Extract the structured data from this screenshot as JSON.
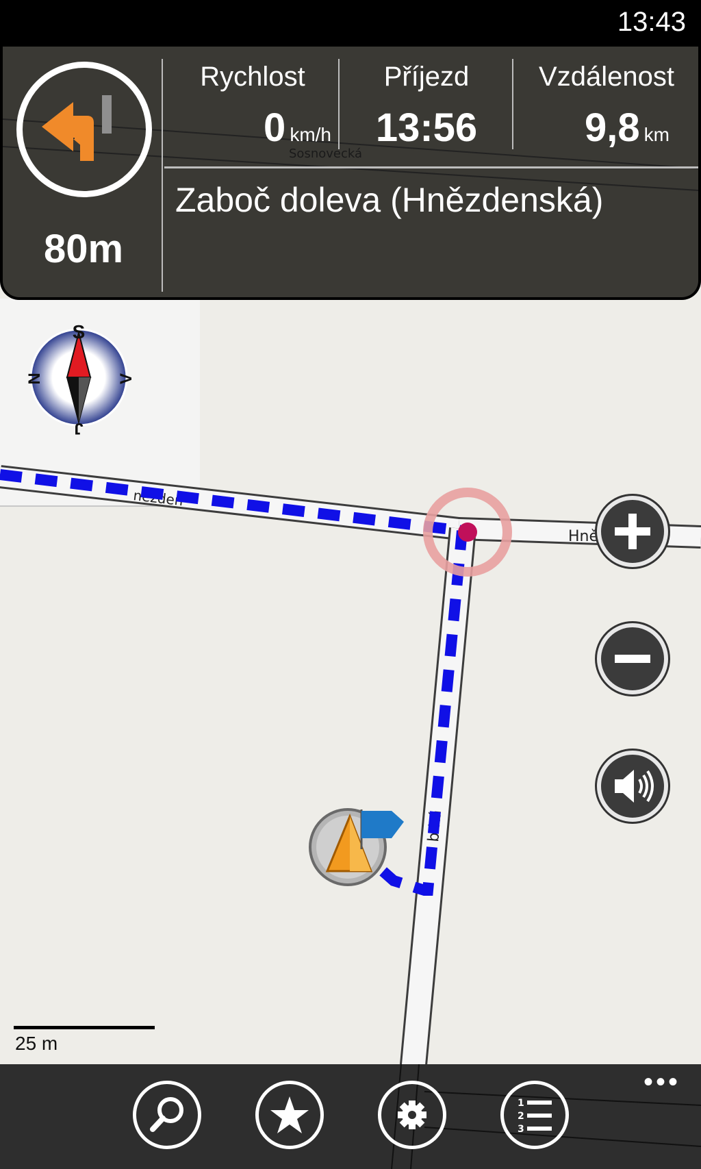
{
  "status_bar": {
    "time": "13:43"
  },
  "nav": {
    "turn_distance": "80m",
    "speed": {
      "label": "Rychlost",
      "value": "0",
      "unit": "km/h"
    },
    "arrival": {
      "label": "Příjezd",
      "value": "13:56"
    },
    "distance": {
      "label": "Vzdálenost",
      "value": "9,8",
      "unit": "km"
    },
    "instruction": "Zaboč doleva (Hnězdenská)"
  },
  "compass": {
    "top": "S",
    "left": "N",
    "right": "V",
    "bottom": "J"
  },
  "map": {
    "streets": {
      "top": "Sosnovecká",
      "east": "Hnězdenská",
      "west": "nězden",
      "vertical": "b   ká"
    },
    "scale_label": "25 m"
  },
  "colors": {
    "route": "#1010e6",
    "turn_arrow": "#f08a2a",
    "panel": "#3a3934",
    "waypoint": "#e8a0a0"
  },
  "icons": {
    "zoom_in": "plus-icon",
    "zoom_out": "minus-icon",
    "sound": "speaker-icon",
    "search": "search-icon",
    "favorites": "star-icon",
    "settings": "gear-icon",
    "route_list": "numbered-list-icon",
    "more": "ellipsis-icon"
  },
  "appbar": {
    "more": "•••"
  }
}
